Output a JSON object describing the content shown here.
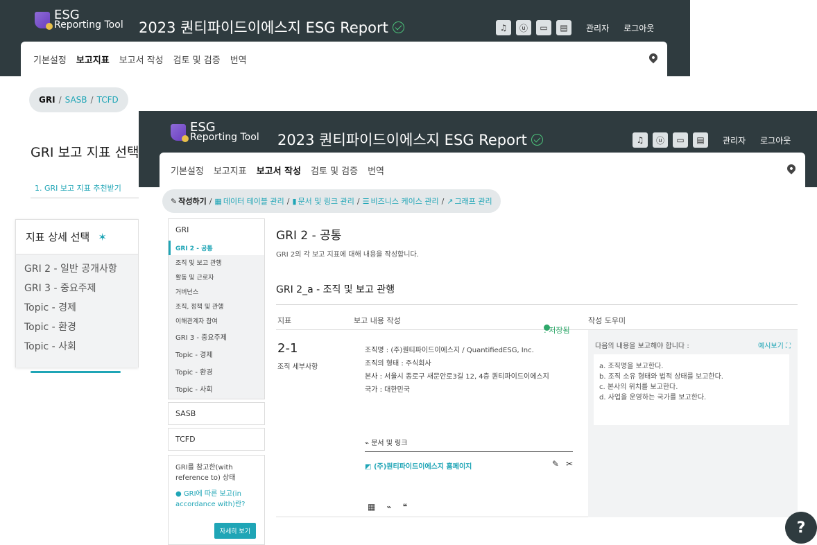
{
  "app": {
    "logo_line1": "ESG",
    "logo_line2": "Reporting Tool",
    "title": "2023 퀀티파이드이에스지 ESG Report",
    "admin_label": "관리자",
    "logout_label": "로그아웃"
  },
  "icons": {
    "bell": "♫",
    "user": "ⓤ",
    "card": "▭",
    "book": "▤"
  },
  "nav": {
    "items": [
      "기본설정",
      "보고지표",
      "보고서 작성",
      "검토 및 검증",
      "번역"
    ]
  },
  "back": {
    "crumb": [
      "GRI",
      "SASB",
      "TCFD"
    ],
    "page_title": "GRI 보고 지표 선택",
    "step1": "1. GRI 보고 지표 추천받기",
    "panel_title": "지표 상세 선택",
    "panel_items": [
      "GRI 2 - 일반 공개사항",
      "GRI 3 - 중요주제",
      "Topic - 경제",
      "Topic - 환경",
      "Topic - 사회"
    ]
  },
  "front": {
    "subnav": {
      "current": "작성하기",
      "links": [
        "데이터 테이블 관리",
        "문서 및 링크 관리",
        "비즈니스 케이스 관리",
        "그래프 관리"
      ]
    },
    "left_menu": {
      "gri_head": "GRI",
      "gri_active": "GRI 2 - 공통",
      "gri_sub": [
        "조직 및 보고 관행",
        "활동 및 근로자",
        "거버넌스",
        "조직, 정책 및 관행",
        "이해관계자 참여"
      ],
      "gri_more": [
        "GRI 3 - 중요주제",
        "Topic - 경제",
        "Topic - 환경",
        "Topic - 사회"
      ],
      "sasb": "SASB",
      "tcfd": "TCFD",
      "info_text": "GRI를 참고한(with reference to) 상태",
      "info_link": "GRI에 따른 보고(in accordance with)란?",
      "info_button": "자세히 보기"
    },
    "main": {
      "title": "GRI 2 - 공통",
      "desc": "GRI 2의 각 보고 지표에 대해 내용을 작성합니다.",
      "section": "GRI 2_a - 조직 및 보고 관행",
      "col_indicator": "지표",
      "col_content": "보고 내용 작성",
      "saved": ": 저장됨",
      "col_helper": "작성 도우미",
      "code": "2-1",
      "code_name": "조직 세부사항",
      "report_lines": [
        "조직명 : (주)퀀티파이드이에스지 / QuantifiedESG, Inc.",
        "조직의 형태 : 주식회사",
        "본사 : 서울시 종로구 새문안로3길 12, 4층 퀀티파이드이에스지",
        "국가 : 대한민국"
      ],
      "docs_head": "문서 및 링크",
      "doc_link": "(주)퀀티파이드이에스지 홈페이지",
      "helper_head": "다음의 내용을 보고해야 합니다 :",
      "helper_example": "예시보기",
      "helper_items": [
        "a. 조직명을 보고한다.",
        "b. 조직 소유 형태와 법적 상태를 보고한다.",
        "c. 본사의 위치를 보고한다.",
        "d. 사업을 운영하는 국가를 보고한다."
      ]
    }
  },
  "help": "?"
}
